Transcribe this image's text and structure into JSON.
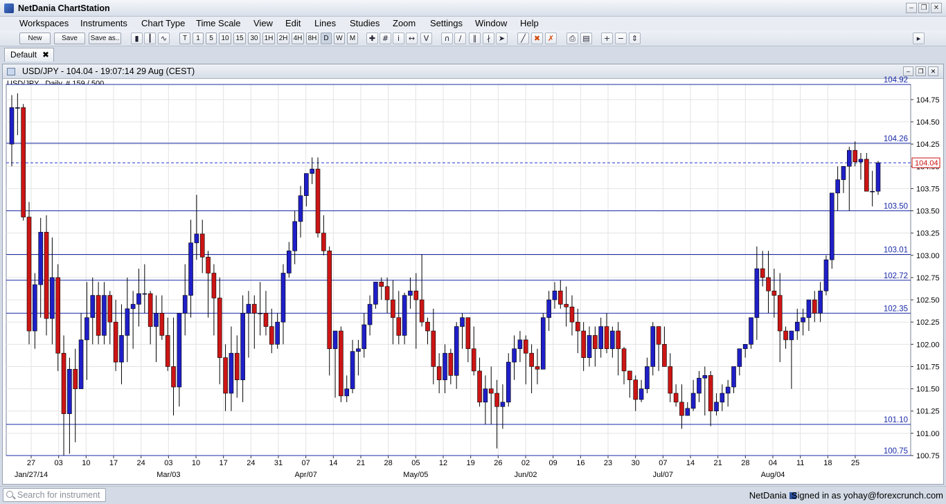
{
  "window": {
    "title": "NetDania ChartStation"
  },
  "menu": [
    "Workspaces",
    "Instruments",
    "Chart Type",
    "Time Scale",
    "View",
    "Edit",
    "Lines",
    "Studies",
    "Zoom",
    "Settings",
    "Window",
    "Help"
  ],
  "toolbar": {
    "new_label": "New",
    "save_label": "Save",
    "saveas_label": "Save as..",
    "timescales": [
      "T",
      "1",
      "5",
      "10",
      "15",
      "30",
      "1H",
      "2H",
      "4H",
      "8H",
      "D",
      "W",
      "M"
    ]
  },
  "tabs": [
    {
      "label": "Default"
    }
  ],
  "chart_window": {
    "title": "USD/JPY - 104.04 - 19:07:14  29 Aug (CEST)",
    "info": "USD/JPY , Daily, # 159 / 500"
  },
  "statusbar": {
    "search_placeholder": "Search for instrument",
    "brand": "NetDania",
    "signed_in": "Signed in as yohay@forexcrunch.com"
  },
  "chart_data": {
    "type": "candlestick",
    "instrument": "USD/JPY",
    "ylim": [
      100.75,
      104.92
    ],
    "y_ticks": [
      "104.75",
      "104.50",
      "104.25",
      "104.00",
      "103.75",
      "103.50",
      "103.25",
      "103.00",
      "102.75",
      "102.50",
      "102.25",
      "102.00",
      "101.75",
      "101.50",
      "101.25",
      "101.00",
      "100.75"
    ],
    "h_lines": [
      "104.92",
      "104.26",
      "103.50",
      "103.01",
      "102.72",
      "102.35",
      "101.10",
      "100.75"
    ],
    "current_price": "104.04",
    "x_ticks": [
      "27",
      "03",
      "10",
      "17",
      "24",
      "03",
      "10",
      "17",
      "24",
      "31",
      "07",
      "14",
      "21",
      "28",
      "05",
      "12",
      "19",
      "26",
      "02",
      "09",
      "16",
      "23",
      "30",
      "07",
      "14",
      "21",
      "28",
      "04",
      "11",
      "18",
      "25"
    ],
    "month_labels": [
      "Jan/27/14",
      "Mar/03",
      "Apr/07",
      "May/05",
      "Jun/02",
      "Jul/07",
      "Aug/04"
    ],
    "ohlc": [
      [
        104.25,
        104.8,
        104.0,
        104.66
      ],
      [
        104.66,
        104.82,
        104.35,
        104.66
      ],
      [
        104.66,
        104.7,
        103.39,
        103.43
      ],
      [
        103.43,
        103.6,
        102.0,
        102.15
      ],
      [
        102.15,
        102.8,
        101.95,
        102.67
      ],
      [
        102.67,
        103.42,
        102.3,
        103.26
      ],
      [
        103.26,
        103.45,
        102.1,
        102.29
      ],
      [
        102.29,
        103.2,
        102.0,
        102.75
      ],
      [
        102.75,
        102.9,
        101.7,
        101.9
      ],
      [
        101.9,
        102.1,
        100.75,
        101.22
      ],
      [
        101.22,
        101.85,
        100.77,
        101.72
      ],
      [
        101.72,
        101.95,
        100.9,
        101.5
      ],
      [
        101.5,
        102.35,
        101.5,
        102.05
      ],
      [
        102.05,
        102.7,
        101.6,
        102.3
      ],
      [
        102.3,
        102.75,
        102.0,
        102.55
      ],
      [
        102.55,
        102.7,
        102.0,
        102.1
      ],
      [
        102.1,
        102.7,
        102.0,
        102.55
      ],
      [
        102.55,
        102.6,
        102.0,
        102.25
      ],
      [
        102.25,
        102.5,
        101.7,
        101.8
      ],
      [
        101.8,
        102.45,
        101.55,
        102.1
      ],
      [
        102.1,
        102.75,
        101.8,
        102.4
      ],
      [
        102.4,
        102.6,
        101.95,
        102.45
      ],
      [
        102.45,
        102.85,
        102.2,
        102.57
      ],
      [
        102.57,
        102.9,
        102.35,
        102.57
      ],
      [
        102.57,
        102.6,
        102.0,
        102.2
      ],
      [
        102.2,
        102.55,
        101.8,
        102.35
      ],
      [
        102.35,
        102.55,
        102.05,
        102.1
      ],
      [
        102.1,
        102.3,
        101.7,
        101.75
      ],
      [
        101.75,
        102.3,
        101.2,
        101.52
      ],
      [
        101.52,
        102.35,
        101.3,
        102.35
      ],
      [
        102.35,
        102.9,
        102.1,
        102.55
      ],
      [
        102.55,
        103.4,
        102.3,
        103.14
      ],
      [
        103.14,
        103.68,
        102.95,
        103.24
      ],
      [
        103.24,
        103.4,
        102.8,
        102.98
      ],
      [
        102.98,
        103.05,
        102.3,
        102.8
      ],
      [
        102.8,
        102.9,
        102.1,
        102.52
      ],
      [
        102.52,
        102.75,
        101.55,
        101.85
      ],
      [
        101.85,
        102.0,
        101.25,
        101.45
      ],
      [
        101.45,
        102.2,
        101.25,
        101.9
      ],
      [
        101.9,
        102.1,
        101.4,
        101.6
      ],
      [
        101.6,
        102.55,
        101.35,
        102.35
      ],
      [
        102.35,
        102.6,
        101.85,
        102.45
      ],
      [
        102.45,
        102.55,
        101.95,
        102.35
      ],
      [
        102.35,
        102.7,
        102.1,
        102.35
      ],
      [
        102.35,
        102.6,
        102.1,
        102.2
      ],
      [
        102.2,
        102.4,
        101.9,
        102.0
      ],
      [
        102.0,
        102.35,
        101.95,
        102.25
      ],
      [
        102.25,
        102.9,
        102.0,
        102.8
      ],
      [
        102.8,
        103.15,
        102.75,
        103.05
      ],
      [
        103.05,
        103.5,
        102.9,
        103.38
      ],
      [
        103.38,
        103.78,
        103.2,
        103.67
      ],
      [
        103.67,
        103.9,
        103.55,
        103.92
      ],
      [
        103.92,
        104.1,
        103.8,
        103.97
      ],
      [
        103.97,
        104.1,
        103.2,
        103.25
      ],
      [
        103.25,
        103.45,
        103.0,
        103.05
      ],
      [
        103.05,
        103.1,
        101.65,
        101.95
      ],
      [
        101.95,
        102.15,
        101.4,
        102.15
      ],
      [
        102.15,
        102.2,
        101.35,
        101.42
      ],
      [
        101.42,
        101.65,
        101.35,
        101.5
      ],
      [
        101.5,
        102.05,
        101.45,
        101.92
      ],
      [
        101.92,
        102.05,
        101.65,
        101.95
      ],
      [
        101.95,
        102.35,
        101.85,
        102.22
      ],
      [
        102.22,
        102.55,
        102.1,
        102.45
      ],
      [
        102.45,
        102.7,
        102.4,
        102.7
      ],
      [
        102.7,
        102.75,
        102.5,
        102.65
      ],
      [
        102.65,
        102.75,
        102.35,
        102.5
      ],
      [
        102.5,
        102.72,
        102.0,
        102.3
      ],
      [
        102.3,
        102.6,
        102.0,
        102.1
      ],
      [
        102.1,
        102.58,
        102.0,
        102.55
      ],
      [
        102.55,
        102.75,
        102.4,
        102.6
      ],
      [
        102.6,
        102.8,
        101.95,
        102.5
      ],
      [
        102.5,
        103.01,
        102.2,
        102.25
      ],
      [
        102.25,
        102.3,
        102.0,
        102.15
      ],
      [
        102.15,
        102.4,
        101.55,
        101.75
      ],
      [
        101.75,
        101.9,
        101.45,
        101.6
      ],
      [
        101.6,
        102.0,
        101.45,
        101.9
      ],
      [
        101.9,
        101.95,
        101.55,
        101.65
      ],
      [
        101.65,
        102.25,
        101.5,
        102.2
      ],
      [
        102.2,
        102.35,
        101.95,
        102.3
      ],
      [
        102.3,
        102.3,
        101.8,
        101.95
      ],
      [
        101.95,
        102.2,
        101.65,
        101.7
      ],
      [
        101.7,
        101.85,
        101.3,
        101.35
      ],
      [
        101.35,
        101.65,
        101.1,
        101.5
      ],
      [
        101.5,
        101.75,
        101.1,
        101.45
      ],
      [
        101.45,
        101.6,
        100.83,
        101.3
      ],
      [
        101.3,
        101.55,
        101.05,
        101.35
      ],
      [
        101.35,
        101.9,
        101.3,
        101.8
      ],
      [
        101.8,
        102.1,
        101.6,
        101.95
      ],
      [
        101.95,
        102.15,
        101.8,
        102.05
      ],
      [
        102.05,
        102.1,
        101.55,
        101.9
      ],
      [
        101.9,
        102.0,
        101.45,
        101.75
      ],
      [
        101.75,
        101.95,
        101.55,
        101.72
      ],
      [
        101.72,
        102.35,
        101.9,
        102.3
      ],
      [
        102.3,
        102.6,
        102.15,
        102.5
      ],
      [
        102.5,
        102.7,
        102.4,
        102.6
      ],
      [
        102.6,
        102.72,
        102.4,
        102.45
      ],
      [
        102.45,
        102.65,
        102.2,
        102.42
      ],
      [
        102.42,
        102.55,
        102.1,
        102.25
      ],
      [
        102.25,
        102.4,
        101.9,
        102.15
      ],
      [
        102.15,
        102.25,
        101.7,
        101.85
      ],
      [
        101.85,
        102.2,
        101.75,
        102.1
      ],
      [
        102.1,
        102.2,
        101.75,
        101.95
      ],
      [
        101.95,
        102.3,
        101.85,
        102.2
      ],
      [
        102.2,
        102.35,
        101.9,
        101.95
      ],
      [
        101.95,
        102.2,
        101.85,
        102.15
      ],
      [
        102.15,
        102.25,
        101.65,
        101.95
      ],
      [
        101.95,
        101.97,
        101.55,
        101.7
      ],
      [
        101.7,
        101.7,
        101.4,
        101.6
      ],
      [
        101.6,
        101.65,
        101.25,
        101.38
      ],
      [
        101.38,
        101.6,
        101.35,
        101.5
      ],
      [
        101.5,
        101.85,
        101.45,
        101.75
      ],
      [
        101.75,
        102.25,
        101.65,
        102.2
      ],
      [
        102.2,
        102.2,
        101.7,
        102.0
      ],
      [
        102.0,
        102.2,
        101.75,
        101.75
      ],
      [
        101.75,
        101.9,
        101.35,
        101.45
      ],
      [
        101.45,
        101.55,
        101.3,
        101.35
      ],
      [
        101.35,
        101.55,
        101.05,
        101.2
      ],
      [
        101.2,
        101.35,
        101.2,
        101.28
      ],
      [
        101.28,
        101.6,
        101.25,
        101.45
      ],
      [
        101.45,
        101.7,
        101.35,
        101.62
      ],
      [
        101.62,
        101.75,
        101.2,
        101.65
      ],
      [
        101.65,
        101.7,
        101.08,
        101.25
      ],
      [
        101.25,
        101.45,
        101.2,
        101.35
      ],
      [
        101.35,
        101.55,
        101.25,
        101.45
      ],
      [
        101.45,
        101.6,
        101.3,
        101.52
      ],
      [
        101.52,
        101.75,
        101.45,
        101.75
      ],
      [
        101.75,
        101.9,
        101.65,
        101.95
      ],
      [
        101.95,
        102.0,
        101.85,
        102.0
      ],
      [
        102.0,
        102.15,
        101.95,
        102.3
      ],
      [
        102.3,
        103.1,
        102.05,
        102.85
      ],
      [
        102.85,
        103.05,
        102.65,
        102.75
      ],
      [
        102.75,
        103.05,
        102.35,
        102.6
      ],
      [
        102.6,
        102.85,
        102.3,
        102.55
      ],
      [
        102.55,
        102.8,
        101.8,
        102.15
      ],
      [
        102.15,
        102.2,
        101.95,
        102.05
      ],
      [
        102.05,
        102.15,
        101.5,
        102.15
      ],
      [
        102.15,
        102.4,
        102.05,
        102.25
      ],
      [
        102.25,
        102.4,
        102.1,
        102.3
      ],
      [
        102.3,
        102.45,
        102.15,
        102.5
      ],
      [
        102.5,
        102.6,
        102.25,
        102.35
      ],
      [
        102.35,
        102.7,
        102.25,
        102.6
      ],
      [
        102.6,
        103.0,
        102.55,
        102.95
      ],
      [
        102.95,
        103.02,
        102.85,
        103.7
      ],
      [
        103.7,
        104.0,
        103.5,
        103.85
      ],
      [
        103.85,
        104.0,
        103.7,
        104.0
      ],
      [
        104.0,
        104.22,
        103.5,
        104.18
      ],
      [
        104.18,
        104.28,
        104.0,
        104.05
      ],
      [
        104.05,
        104.15,
        103.85,
        104.08
      ],
      [
        104.08,
        104.15,
        103.9,
        103.72
      ],
      [
        103.72,
        103.95,
        103.55,
        103.72
      ],
      [
        103.72,
        104.06,
        103.68,
        104.04
      ]
    ]
  }
}
